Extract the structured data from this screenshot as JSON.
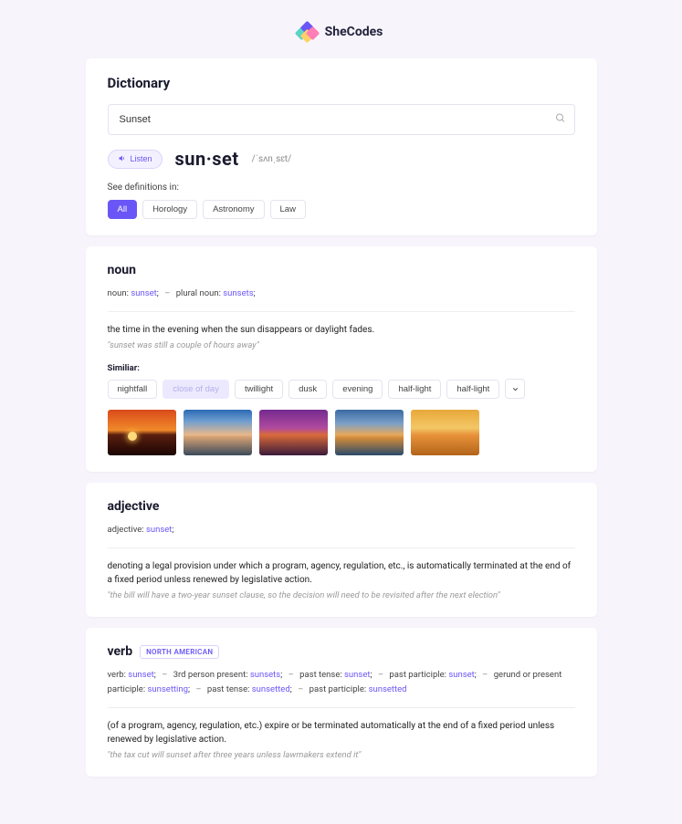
{
  "brand": "SheCodes",
  "header": {
    "title": "Dictionary",
    "search_value": "Sunset",
    "listen_label": "Listen",
    "headword": "sun·set",
    "pronunciation": "/ˈsʌnˌsɛt/",
    "see_definitions_label": "See definitions in:",
    "categories": [
      {
        "label": "All",
        "active": true
      },
      {
        "label": "Horology",
        "active": false
      },
      {
        "label": "Astronomy",
        "active": false
      },
      {
        "label": "Law",
        "active": false
      }
    ]
  },
  "noun": {
    "pos": "noun",
    "forms_text": "noun: sunset;  –  plural noun: sunsets;",
    "definition": "the time in the evening when the sun disappears or daylight fades.",
    "example": "\"sunset was still a couple of hours away\"",
    "similar_label": "Similiar:",
    "similar": [
      "nightfall",
      "close of day",
      "twillight",
      "dusk",
      "evening",
      "half-light",
      "half-light"
    ]
  },
  "adjective": {
    "pos": "adjective",
    "forms_text": "adjective: sunset;",
    "definition": "denoting a legal provision under which a program, agency, regulation, etc., is automatically terminated at the end of a fixed period unless renewed by legislative action.",
    "example": "\"the bill will have a two-year sunset clause, so the decision will need to be revisited after the next election\""
  },
  "verb": {
    "pos": "verb",
    "region": "NORTH AMERICAN",
    "forms_text": "verb: sunset;  –  3rd person present: sunsets;  –  past tense: sunset;  –  past participle: sunset;  –  gerund or present participle: sunsetting;  –  past tense: sunsetted;  –  past participle: sunsetted",
    "definition": "(of a program, agency, regulation, etc.) expire or be terminated automatically at the end of a fixed period unless renewed by legislative action.",
    "example": "\"the tax cut will sunset after three years unless lawmakers extend it\""
  }
}
